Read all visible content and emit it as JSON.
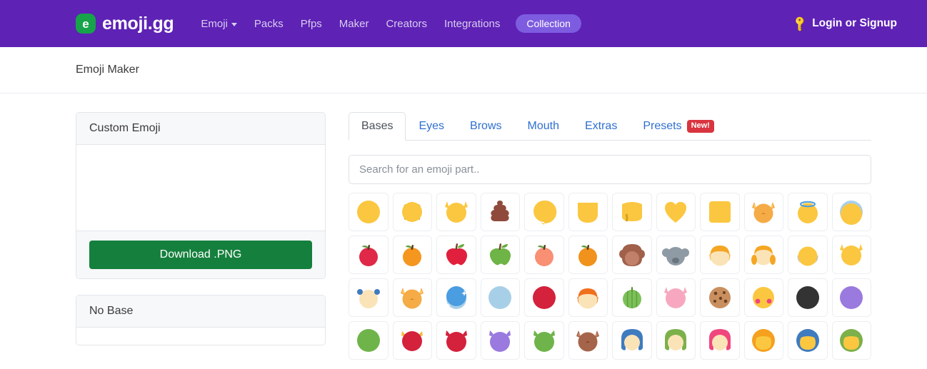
{
  "navbar": {
    "brand_initial": "e",
    "brand_text": "emoji.gg",
    "links": [
      {
        "label": "Emoji",
        "has_caret": true
      },
      {
        "label": "Packs",
        "has_caret": false
      },
      {
        "label": "Pfps",
        "has_caret": false
      },
      {
        "label": "Maker",
        "has_caret": false
      },
      {
        "label": "Creators",
        "has_caret": false
      },
      {
        "label": "Integrations",
        "has_caret": false
      }
    ],
    "pill_label": "Collection",
    "login_label": "Login or Signup",
    "login_icon": "key-icon",
    "background_color": "#5e22b5",
    "pill_color": "#7d5ce0",
    "brand_badge_color": "#17a34a"
  },
  "subheader": {
    "title": "Emoji Maker"
  },
  "left_panel": {
    "custom_emoji_card": {
      "header": "Custom Emoji",
      "download_label": "Download .PNG",
      "download_color": "#15803d"
    },
    "base_card": {
      "header": "No Base"
    }
  },
  "right_panel": {
    "tabs": [
      {
        "label": "Bases",
        "active": true,
        "badge": null
      },
      {
        "label": "Eyes",
        "active": false,
        "badge": null
      },
      {
        "label": "Brows",
        "active": false,
        "badge": null
      },
      {
        "label": "Mouth",
        "active": false,
        "badge": null
      },
      {
        "label": "Extras",
        "active": false,
        "badge": null
      },
      {
        "label": "Presets",
        "active": false,
        "badge": "New!"
      }
    ],
    "search": {
      "value": "",
      "placeholder": "Search for an emoji part.."
    },
    "grid": {
      "rows": 4,
      "columns": 12,
      "items": [
        {
          "name": "base-yellow-circle",
          "shape": "circle",
          "color": "#fbc740"
        },
        {
          "name": "base-yellow-face-ears",
          "shape": "face-ears",
          "color": "#fbc740"
        },
        {
          "name": "base-yellow-cat-ears",
          "shape": "cat-ears",
          "color": "#fbc740"
        },
        {
          "name": "base-poop",
          "shape": "poop",
          "color": "#8f4a3c"
        },
        {
          "name": "base-yellow-teardrop",
          "shape": "teardrop",
          "color": "#fbc740"
        },
        {
          "name": "base-yellow-shield",
          "shape": "shield",
          "color": "#fbc740"
        },
        {
          "name": "base-yellow-squarish",
          "shape": "squarish",
          "color": "#fbc740"
        },
        {
          "name": "base-yellow-heart",
          "shape": "heart",
          "color": "#fbc740"
        },
        {
          "name": "base-yellow-square",
          "shape": "square",
          "color": "#fbc740"
        },
        {
          "name": "base-cat-face",
          "shape": "cat-face",
          "color": "#f5ab46"
        },
        {
          "name": "base-halo-circle",
          "shape": "halo",
          "color": "#fbc740"
        },
        {
          "name": "base-blue-top-circle",
          "shape": "blue-top",
          "color": "#fbc740"
        },
        {
          "name": "base-tomato",
          "shape": "fruit",
          "color": "#e02848"
        },
        {
          "name": "base-orange",
          "shape": "fruit",
          "color": "#f5961e"
        },
        {
          "name": "base-red-apple",
          "shape": "apple",
          "color": "#e0203c"
        },
        {
          "name": "base-green-apple",
          "shape": "apple",
          "color": "#6eb446"
        },
        {
          "name": "base-peach",
          "shape": "fruit",
          "color": "#f98f73"
        },
        {
          "name": "base-tangerine",
          "shape": "fruit",
          "color": "#f0921c"
        },
        {
          "name": "base-monkey",
          "shape": "monkey",
          "color": "#a0604a"
        },
        {
          "name": "base-koala",
          "shape": "koala",
          "color": "#8e9aa4"
        },
        {
          "name": "base-orange-hair-face",
          "shape": "hair-face",
          "color": "#f5a623"
        },
        {
          "name": "base-pigtails-face",
          "shape": "pigtails",
          "color": "#f5a623"
        },
        {
          "name": "base-bald-face",
          "shape": "bald",
          "color": "#fbc740"
        },
        {
          "name": "base-yellow-cat",
          "shape": "cat-ears",
          "color": "#fbc740"
        },
        {
          "name": "base-bows-face",
          "shape": "bows",
          "color": "#fbe3b8"
        },
        {
          "name": "base-orange-cat",
          "shape": "cat-face",
          "color": "#f5ab46"
        },
        {
          "name": "base-snowball",
          "shape": "snowball",
          "color": "#4a9de0"
        },
        {
          "name": "base-light-blue-circle",
          "shape": "circle",
          "color": "#a8cfe8"
        },
        {
          "name": "base-red-circle",
          "shape": "circle",
          "color": "#d4213c"
        },
        {
          "name": "base-orange-hair-pale",
          "shape": "hair-face",
          "color": "#f0701e"
        },
        {
          "name": "base-melon",
          "shape": "melon",
          "color": "#7cc05a"
        },
        {
          "name": "base-pink-pig",
          "shape": "cat-ears",
          "color": "#f7a8c0"
        },
        {
          "name": "base-cookie",
          "shape": "cookie",
          "color": "#c98f5e"
        },
        {
          "name": "base-blush-face",
          "shape": "blush",
          "color": "#fbc740"
        },
        {
          "name": "base-black-circle",
          "shape": "circle",
          "color": "#333333"
        },
        {
          "name": "base-purple-circle",
          "shape": "circle",
          "color": "#9a7ade"
        },
        {
          "name": "base-green-circle",
          "shape": "circle",
          "color": "#6fb44a"
        },
        {
          "name": "base-red-horns",
          "shape": "horns",
          "color": "#d4213c"
        },
        {
          "name": "base-red-devil",
          "shape": "devil",
          "color": "#d4213c"
        },
        {
          "name": "base-purple-devil",
          "shape": "devil",
          "color": "#9a7ade"
        },
        {
          "name": "base-green-devil",
          "shape": "devil",
          "color": "#6fb44a"
        },
        {
          "name": "base-brown-cat",
          "shape": "cat-face",
          "color": "#a5654a"
        },
        {
          "name": "base-blue-hair-face",
          "shape": "longhair",
          "color": "#3f7bbf"
        },
        {
          "name": "base-green-hair-face",
          "shape": "longhair",
          "color": "#7cb04a"
        },
        {
          "name": "base-pink-hair-face",
          "shape": "longhair",
          "color": "#f0467e"
        },
        {
          "name": "base-orange-afro",
          "shape": "afro",
          "color": "#f5a01e"
        },
        {
          "name": "base-blue-afro",
          "shape": "afro",
          "color": "#3f7bbf"
        },
        {
          "name": "base-green-afro",
          "shape": "afro",
          "color": "#7cb04a"
        }
      ]
    }
  }
}
